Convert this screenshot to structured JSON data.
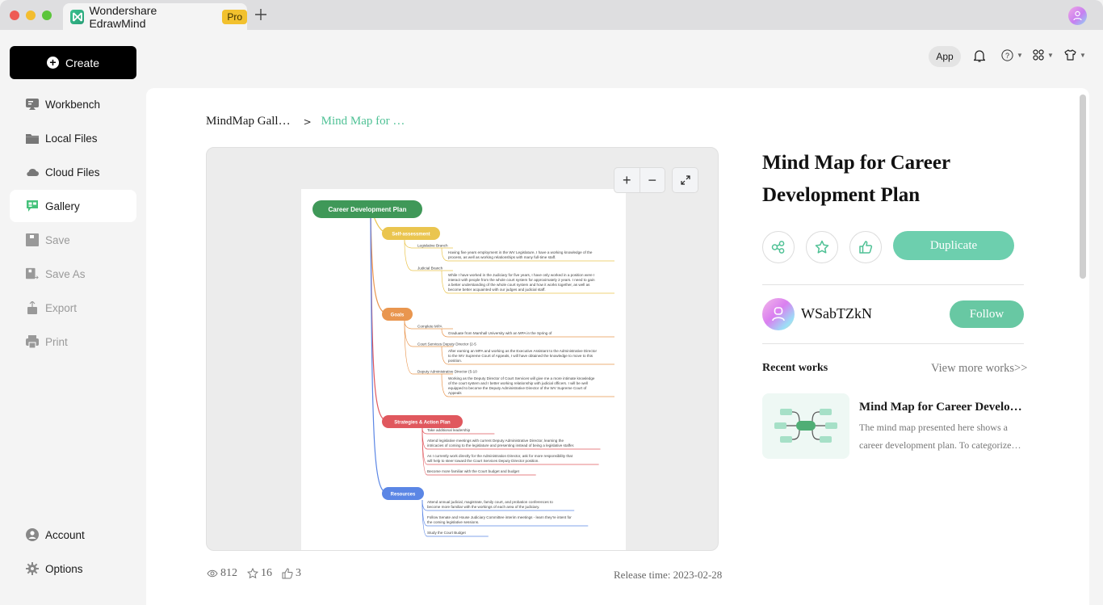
{
  "window": {
    "tab_title": "Wondershare EdrawMind",
    "pro_badge": "Pro",
    "new_tab_icon": "plus-icon"
  },
  "topbar": {
    "app_label": "App",
    "icons": [
      "bell-icon",
      "help-icon",
      "apps-grid-icon",
      "skin-shirt-icon"
    ]
  },
  "sidebar": {
    "create_label": "Create",
    "items": [
      {
        "label": "Workbench",
        "icon": "workbench-icon",
        "state": "normal"
      },
      {
        "label": "Local Files",
        "icon": "folder-icon",
        "state": "normal"
      },
      {
        "label": "Cloud Files",
        "icon": "cloud-icon",
        "state": "normal"
      },
      {
        "label": "Gallery",
        "icon": "gallery-icon",
        "state": "active"
      },
      {
        "label": "Save",
        "icon": "save-icon",
        "state": "disabled"
      },
      {
        "label": "Save As",
        "icon": "save-as-icon",
        "state": "disabled"
      },
      {
        "label": "Export",
        "icon": "export-icon",
        "state": "disabled"
      },
      {
        "label": "Print",
        "icon": "print-icon",
        "state": "disabled"
      }
    ],
    "bottom_items": [
      {
        "label": "Account",
        "icon": "account-icon"
      },
      {
        "label": "Options",
        "icon": "gear-icon"
      }
    ]
  },
  "breadcrumb": {
    "parent": "MindMap Gall…",
    "current": "Mind Map for …"
  },
  "preview": {
    "zoom_in": "+",
    "zoom_out": "−",
    "mindmap": {
      "root": "Career Development Plan",
      "branches": [
        {
          "label": "Self-assessment",
          "color": "#eac54f",
          "children": [
            {
              "label": "Legislative Branch",
              "detail": [
                "Having five years employment in the WV Legislature, I have a working knowledge of the",
                "process, as well as working relationships with many full-time staff."
              ]
            },
            {
              "label": "Judicial Branch",
              "detail": [
                "While I have worked in the Judiciary for five years, I have only worked in a position were I",
                "interact with people from the whole court system for approximately 2 years.  I need to gain",
                "a better understanding of the whole court system and how it works together, as well as",
                "become better acquainted with our judges and judicial staff."
              ]
            }
          ]
        },
        {
          "label": "Goals",
          "color": "#e9964f",
          "children": [
            {
              "label": "Complete MPA",
              "detail": [
                "Graduate from Marshall University with an MPA in the Spring of"
              ]
            },
            {
              "label": "Court Services Deputy Director (2-5",
              "detail": [
                "After earning an MPA and working as the Executive Assistant to the Administrative Director",
                "to the WV Supreme Court of Appeals, I will have obtained the knowledge to move to this",
                "position."
              ]
            },
            {
              "label": "Deputy Administrative Director (5-10",
              "detail": [
                "Working as the Deputy Director of Court Services will give me a more intimate knowledge",
                "of the court system and I better working relationship with judicial officers.  I will be well",
                "equipped to become the Deputy Administrative Director of the WV Supreme Court of",
                "Appeals"
              ]
            }
          ]
        },
        {
          "label": "Strategies & Action Plan",
          "color": "#e0585e",
          "items": [
            [
              "Take additional leadership"
            ],
            [
              "Attend legislative meetings with current Deputy Administrative Director, learning the",
              "intricacies of coming to the legislature and presenting instead of being a legislative staffer."
            ],
            [
              "As I currently work directly for the Administration Director, ask for more responsibility that",
              "will help to steer toward the Court Services Deputy Director position."
            ],
            [
              "Become more familiar with the Court budget and budget"
            ]
          ]
        },
        {
          "label": "Resources",
          "color": "#5b86e5",
          "items": [
            [
              "Attend annual judicial, magistrate, family court, and probation conferences to",
              "become more familiar with the workings of each area of the judiciary."
            ],
            [
              "Follow Senate and House Judiciary Committee interim meetings - learn they're intent for",
              "the coming legislative sessions."
            ],
            [
              "Study the Court Budget"
            ]
          ]
        }
      ]
    }
  },
  "stats": {
    "views": "812",
    "favorites": "16",
    "likes": "3",
    "release_label": "Release time:",
    "release_date": "2023-02-28"
  },
  "detail": {
    "title": "Mind Map for Career Development Plan",
    "duplicate_label": "Duplicate",
    "author_name": "WSabTZkN",
    "follow_label": "Follow",
    "recent_label": "Recent works",
    "view_more_label": "View more works>>",
    "recent_works": [
      {
        "title": "Mind Map for Career Develop…",
        "description": "The mind map presented here shows a career development plan. To categorize…"
      }
    ]
  },
  "colors": {
    "accent": "#6dcfae",
    "follow": "#68c8a3",
    "breadcrumb_current": "#4fc195",
    "root_node": "#3f9858"
  }
}
